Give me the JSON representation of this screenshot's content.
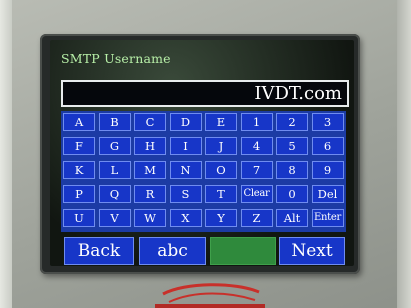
{
  "screen": {
    "title": "SMTP Username",
    "entry_value": "IVDT.com"
  },
  "keyboard": {
    "rows": [
      [
        "A",
        "B",
        "C",
        "D",
        "E",
        "1",
        "2",
        "3"
      ],
      [
        "F",
        "G",
        "H",
        "I",
        "J",
        "4",
        "5",
        "6"
      ],
      [
        "K",
        "L",
        "M",
        "N",
        "O",
        "7",
        "8",
        "9"
      ],
      [
        "P",
        "Q",
        "R",
        "S",
        "T",
        "Clear",
        "0",
        "Del"
      ],
      [
        "U",
        "V",
        "W",
        "X",
        "Y",
        "Z",
        "Alt",
        "Enter"
      ]
    ]
  },
  "bottom_bar": {
    "back_label": "Back",
    "mode_label": "abc",
    "next_label": "Next"
  },
  "colors": {
    "key_blue": "#1736c8",
    "key_border": "#6f8cf0",
    "title_green": "#b8f0a8",
    "blank_key_green": "#2f8a3c",
    "logo_red": "#c8302a"
  },
  "icons": {
    "bottom_logo": "ivdt-logo-icon"
  }
}
